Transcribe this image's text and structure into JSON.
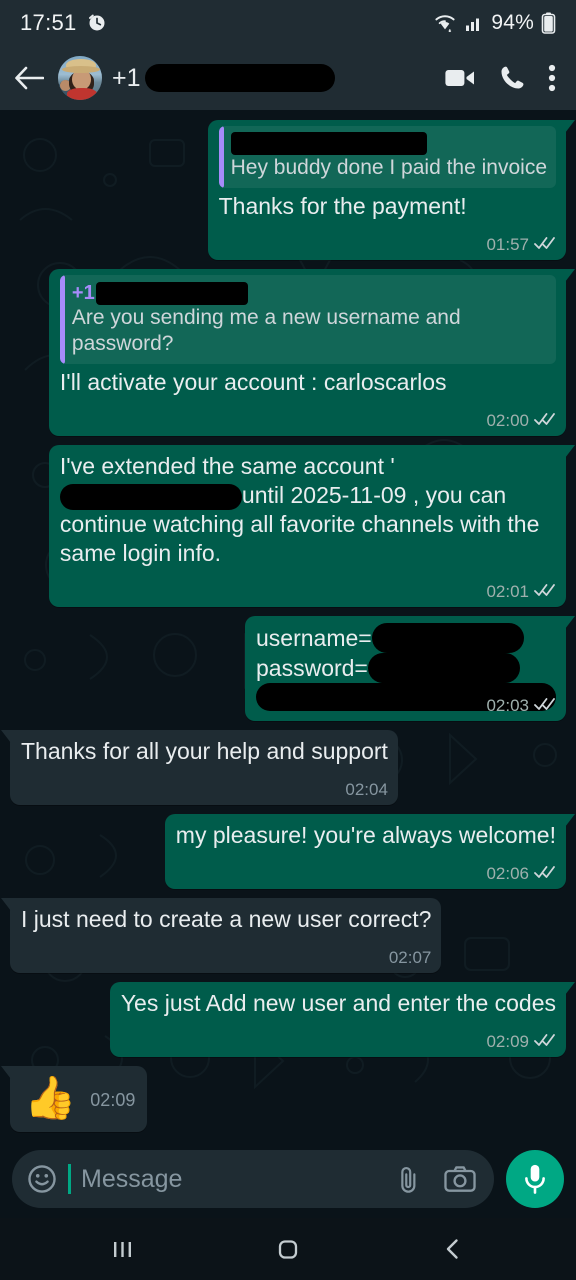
{
  "status_bar": {
    "time": "17:51",
    "alarm_icon": "alarm-clock-icon",
    "wifi_icon": "wifi-icon",
    "signal_icon": "cellular-signal-icon",
    "battery_percent": "94%",
    "battery_icon": "battery-icon"
  },
  "header": {
    "back_icon": "back-arrow-icon",
    "avatar": "contact-avatar",
    "name_prefix": "+1",
    "name_redacted": true,
    "video_call_icon": "video-camera-icon",
    "voice_call_icon": "phone-icon",
    "menu_icon": "overflow-menu-icon"
  },
  "colors": {
    "outgoing_bubble": "#005c4b",
    "incoming_bubble": "#1f2c33",
    "chat_background": "#0a1319",
    "header_background": "#202c33",
    "accent_green": "#00a884",
    "quote_accent": "#a78bfa",
    "text_primary": "#e9edef",
    "text_meta": "#8696a0"
  },
  "messages": [
    {
      "id": "msg-1",
      "direction": "out",
      "quote": {
        "author_prefix": "",
        "author_redacted": true,
        "text": "Hey buddy done I paid the invoice"
      },
      "text": "Thanks for the payment!",
      "time": "01:57",
      "ticks": "double-check",
      "meta_inline": true
    },
    {
      "id": "msg-2",
      "direction": "out",
      "quote": {
        "author_prefix": "+1",
        "author_redacted": true,
        "text": "Are you sending me a new username and password?"
      },
      "text": "I'll activate your account : carloscarlos",
      "time": "02:00",
      "ticks": "double-check",
      "meta_inline": false
    },
    {
      "id": "msg-3",
      "direction": "out",
      "text_before": "I've extended the same account '",
      "text_redacted": true,
      "text_after": "until 2025-11-09 , you can continue watching all favorite channels with the same login info.",
      "time": "02:01",
      "ticks": "double-check",
      "meta_inline": true
    },
    {
      "id": "msg-4",
      "direction": "out",
      "credentials": [
        {
          "label": "username=",
          "value_redacted": true
        },
        {
          "label": "password=",
          "value_redacted": true
        },
        {
          "label": "",
          "value_redacted": true
        }
      ],
      "time": "02:03",
      "ticks": "double-check"
    },
    {
      "id": "msg-5",
      "direction": "in",
      "text": "Thanks for all your help and support",
      "time": "02:04",
      "ticks": "none",
      "meta_inline": false
    },
    {
      "id": "msg-6",
      "direction": "out",
      "text": "my pleasure! you're always welcome!",
      "time": "02:06",
      "ticks": "double-check",
      "meta_inline": false
    },
    {
      "id": "msg-7",
      "direction": "in",
      "text": "I just need to create a new user correct?",
      "time": "02:07",
      "ticks": "none",
      "meta_inline": false
    },
    {
      "id": "msg-8",
      "direction": "out",
      "text": "Yes just Add new user and enter the codes",
      "time": "02:09",
      "ticks": "double-check",
      "meta_inline": true
    },
    {
      "id": "msg-9",
      "direction": "in",
      "emoji": "👍",
      "time": "02:09",
      "ticks": "none"
    }
  ],
  "composer": {
    "emoji_icon": "emoji-smiley-icon",
    "placeholder": "Message",
    "attach_icon": "paperclip-icon",
    "camera_icon": "camera-icon",
    "mic_icon": "microphone-icon"
  },
  "nav_bar": {
    "recents_icon": "recent-apps-icon",
    "home_icon": "home-icon",
    "back_icon": "android-back-icon"
  }
}
